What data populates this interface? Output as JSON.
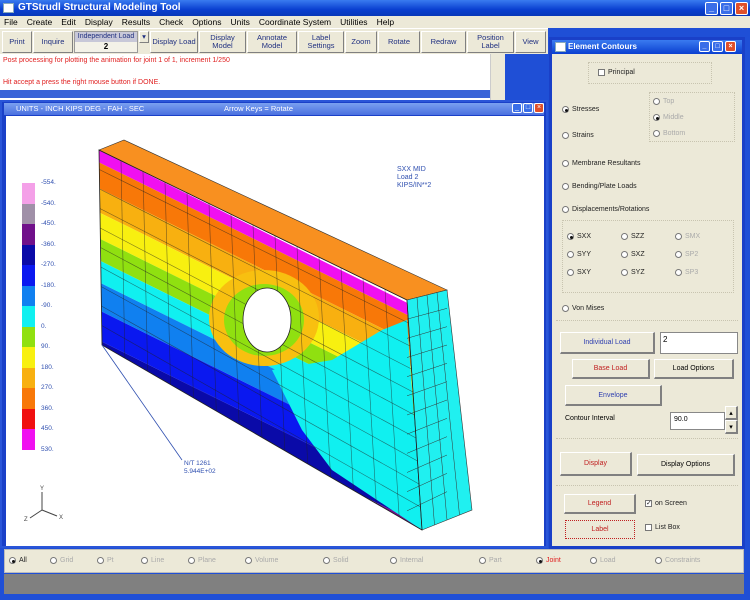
{
  "window": {
    "title": "GTStrudl Structural Modeling Tool",
    "controls": [
      "minimize",
      "maximize",
      "close"
    ]
  },
  "menu": [
    "File",
    "Create",
    "Edit",
    "Display",
    "Results",
    "Check",
    "Options",
    "Units",
    "Coordinate System",
    "Utilities",
    "Help"
  ],
  "toolbar": {
    "print": "Print",
    "inquire": "Inquire",
    "independent_load_label": "Independent Load",
    "independent_load_value": "2",
    "display_load": "Display Load",
    "display_model": "Display Model",
    "annotate_model": "Annotate Model",
    "label_settings": "Label Settings",
    "zoom": "Zoom",
    "rotate": "Rotate",
    "redraw": "Redraw",
    "position_label": "Position Label",
    "view": "View"
  },
  "messages": [
    "Post processing for plotting the animation for joint 1 of 1, increment 1/250",
    "Hit accept a press the right mouse button if DONE."
  ],
  "viewport": {
    "title": "UNITS - INCH KIPS DEG - FAH - SEC",
    "hint": "Arrow Keys = Rotate",
    "info": [
      "SXX   MID",
      "Load   2",
      "KIPS/IN**2"
    ],
    "annotation": [
      "N/T 1261",
      "5.944E+02"
    ],
    "axes": [
      "Y",
      "X",
      "Z"
    ]
  },
  "legend": {
    "values": [
      "-554.",
      "-540.",
      "-450.",
      "-360.",
      "-270.",
      "-180.",
      "-90.",
      "0.",
      "90.",
      "180.",
      "270.",
      "360.",
      "450.",
      "530."
    ],
    "colors": [
      "#f4a0e8",
      "#a090a8",
      "#70108a",
      "#0a0aa8",
      "#0a18f0",
      "#1080f0",
      "#10f0f0",
      "#90e010",
      "#f8f010",
      "#f8b010",
      "#f87808",
      "#f01010",
      "#f010f0"
    ]
  },
  "dialog": {
    "title": "Element Contours",
    "principal": "Principal",
    "type_options": [
      {
        "label": "Stresses",
        "selected": true
      },
      {
        "label": "Strains",
        "selected": false
      },
      {
        "label": "Membrane Resultants",
        "selected": false
      },
      {
        "label": "Bending/Plate Loads",
        "selected": false
      },
      {
        "label": "Displacements/Rotations",
        "selected": false
      }
    ],
    "surface_options": [
      {
        "label": "Top",
        "selected": false
      },
      {
        "label": "Middle",
        "selected": true
      },
      {
        "label": "Bottom",
        "selected": false
      }
    ],
    "components": [
      {
        "label": "SXX",
        "selected": true,
        "enabled": true
      },
      {
        "label": "SZZ",
        "selected": false,
        "enabled": true
      },
      {
        "label": "SMX",
        "selected": false,
        "enabled": false
      },
      {
        "label": "SYY",
        "selected": false,
        "enabled": true
      },
      {
        "label": "SXZ",
        "selected": false,
        "enabled": true
      },
      {
        "label": "SP2",
        "selected": false,
        "enabled": false
      },
      {
        "label": "SXY",
        "selected": false,
        "enabled": true
      },
      {
        "label": "SYZ",
        "selected": false,
        "enabled": true
      },
      {
        "label": "SP3",
        "selected": false,
        "enabled": false
      }
    ],
    "von_mises": "Von Mises",
    "individual_load": "Individual Load",
    "individual_load_value": "2",
    "base_load": "Base Load",
    "load_options": "Load Options",
    "envelope": "Envelope",
    "contour_interval_label": "Contour Interval",
    "contour_interval_value": "90.0",
    "display": "Display",
    "display_options": "Display Options",
    "legend": "Legend",
    "on_screen": "on Screen",
    "on_screen_checked": true,
    "label": "Label",
    "list_box": "List Box",
    "list_box_checked": false
  },
  "bottom_filters": [
    {
      "label": "All",
      "selected": true
    },
    {
      "label": "Grid",
      "selected": false
    },
    {
      "label": "Pt",
      "selected": false
    },
    {
      "label": "Line",
      "selected": false
    },
    {
      "label": "Plane",
      "selected": false
    },
    {
      "label": "Volume",
      "selected": false
    },
    {
      "label": "Solid",
      "selected": false
    },
    {
      "label": "Internal",
      "selected": false
    },
    {
      "label": "Part",
      "selected": false
    },
    {
      "label": "Joint",
      "selected": true
    },
    {
      "label": "Load",
      "selected": false
    },
    {
      "label": "Constraints",
      "selected": false
    }
  ]
}
